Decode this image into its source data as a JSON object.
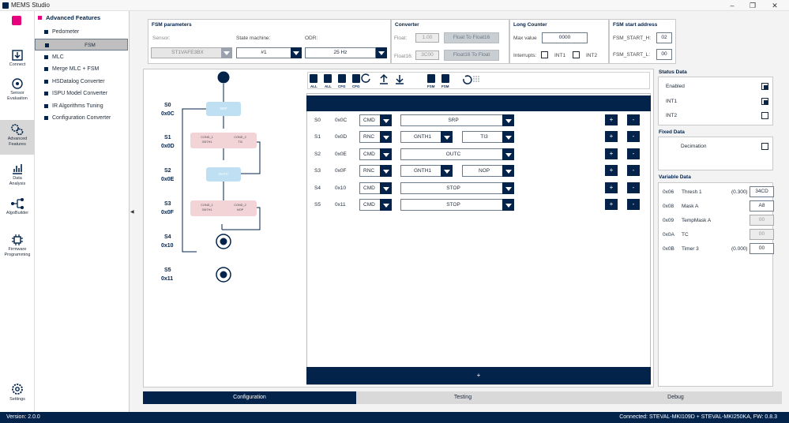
{
  "app": {
    "title": "MEMS Studio"
  },
  "leftnav": [
    {
      "key": "connect",
      "label1": "Connect",
      "label2": ""
    },
    {
      "key": "sensor",
      "label1": "Sensor",
      "label2": "Evaluation"
    },
    {
      "key": "advanced",
      "label1": "Advanced",
      "label2": "Features"
    },
    {
      "key": "data",
      "label1": "Data",
      "label2": "Analysis"
    },
    {
      "key": "algo",
      "label1": "AlgoBuilder",
      "label2": ""
    },
    {
      "key": "firmware",
      "label1": "Firmware",
      "label2": "Programming"
    },
    {
      "key": "settings",
      "label1": "Settings",
      "label2": ""
    }
  ],
  "menu": {
    "header": "Advanced Features",
    "items": [
      "Pedometer",
      "FSM",
      "MLC",
      "Merge MLC + FSM",
      "HSDatalog Converter",
      "ISPU Model Converter",
      "IR Algorithms Tuning",
      "Configuration Converter"
    ],
    "selected": "FSM"
  },
  "fsm_params": {
    "title": "FSM parameters",
    "sensor_label": "Sensor:",
    "sensor_value": "ST1VAFE3BX",
    "state_machine_label": "State machine:",
    "state_machine_value": "#1",
    "odr_label": "ODR:",
    "odr_value": "25 Hz"
  },
  "converter": {
    "title": "Converter",
    "float_label": "Float:",
    "float_value": "1.00",
    "float_btn": "Float To Float16",
    "float16_label": "Float16:",
    "float16_value": "3C00",
    "float16_btn": "Float16 To Float"
  },
  "long_counter": {
    "title": "Long Counter",
    "max_label": "Max value",
    "max_value": "0000",
    "interrupts_label": "Interrupts:",
    "int1": "INT1",
    "int2": "INT2"
  },
  "start_addr": {
    "title": "FSM start address",
    "h_label": "FSM_START_H:",
    "h_value": "02",
    "l_label": "FSM_START_L:",
    "l_value": "00"
  },
  "toolbar": {
    "icons": [
      "save-all-icon",
      "load-all-icon",
      "save-cfg-icon",
      "load-cfg-icon",
      "sync-icon",
      "upload-icon",
      "download-icon",
      "save-fsm-icon",
      "load-fsm-icon",
      "reset-icon",
      "grid-icon"
    ],
    "labels": [
      "ALL",
      "ALL",
      "CFG",
      "CFG",
      "",
      "",
      "",
      "FSM",
      "FSM",
      "",
      ""
    ]
  },
  "graph": {
    "states": [
      {
        "name": "S0",
        "addr": "0x0C"
      },
      {
        "name": "S1",
        "addr": "0x0D"
      },
      {
        "name": "S2",
        "addr": "0x0E"
      },
      {
        "name": "S3",
        "addr": "0x0F"
      },
      {
        "name": "S4",
        "addr": "0x10"
      },
      {
        "name": "S5",
        "addr": "0x11"
      }
    ],
    "nodes": {
      "srp": "SRP",
      "outc": "OUTC"
    },
    "cond1": {
      "a1": "COND_1",
      "a2": "GNTH1",
      "b1": "COND_2",
      "b2": "TI3"
    },
    "cond3": {
      "a1": "COND_1",
      "a2": "GNTH1",
      "b1": "COND_2",
      "b2": "NOP"
    }
  },
  "table": {
    "rows": [
      {
        "state": "S0",
        "addr": "0x0C",
        "type": "CMD",
        "full": "SRP"
      },
      {
        "state": "S1",
        "addr": "0x0D",
        "type": "RNC",
        "a": "GNTH1",
        "b": "TI3"
      },
      {
        "state": "S2",
        "addr": "0x0E",
        "type": "CMD",
        "full": "OUTC"
      },
      {
        "state": "S3",
        "addr": "0x0F",
        "type": "RNC",
        "a": "GNTH1",
        "b": "NOP"
      },
      {
        "state": "S4",
        "addr": "0x10",
        "type": "CMD",
        "full": "STOP"
      },
      {
        "state": "S5",
        "addr": "0x11",
        "type": "CMD",
        "full": "STOP"
      }
    ],
    "plus": "+",
    "minus": "-",
    "add_label": "+"
  },
  "status_data": {
    "title": "Status Data",
    "enabled": "Enabled",
    "int1": "INT1",
    "int2": "INT2"
  },
  "fixed_data": {
    "title": "Fixed Data",
    "decimation": "Decimation"
  },
  "variable_data": {
    "title": "Variable Data",
    "rows": [
      {
        "addr": "0x06",
        "name": "Thresh 1",
        "extra": "(0.300)",
        "value": "34CD"
      },
      {
        "addr": "0x08",
        "name": "Mask A",
        "extra": "",
        "value": "A8"
      },
      {
        "addr": "0x09",
        "name": "TempMask A",
        "extra": "",
        "value": "00"
      },
      {
        "addr": "0x0A",
        "name": "TC",
        "extra": "",
        "value": "00"
      },
      {
        "addr": "0x0B",
        "name": "Timer 3",
        "extra": "(0.000)",
        "value": "00"
      }
    ]
  },
  "tabs": [
    "Configuration",
    "Testing",
    "Debug"
  ],
  "status": {
    "version": "Version: 2.0.0",
    "connected": "Connected:  STEVAL-MKI109D + STEVAL-MKI250KA, FW: 0.8.3"
  },
  "colors": {
    "navy": "#03234b",
    "pink": "#e6007e",
    "node_blue": "#bfe0f3",
    "cond_pink": "#f3d4d6"
  }
}
